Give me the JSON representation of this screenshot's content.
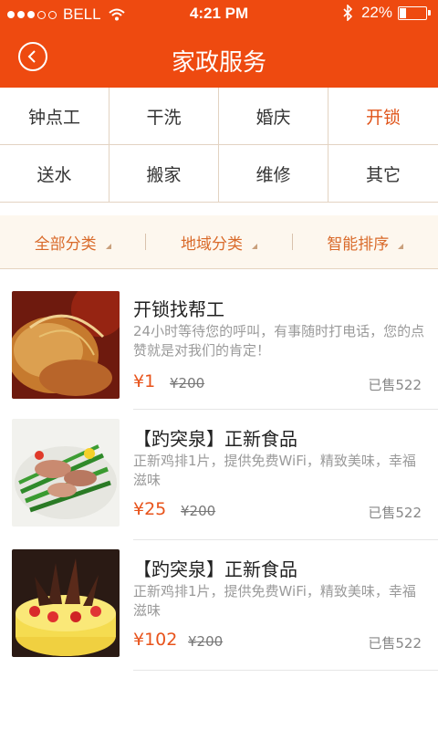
{
  "status_bar": {
    "carrier": "BELL",
    "time": "4:21 PM",
    "battery": "22%"
  },
  "header": {
    "title": "家政服务"
  },
  "categories": [
    "钟点工",
    "干洗",
    "婚庆",
    "开锁",
    "送水",
    "搬家",
    "维修",
    "其它"
  ],
  "active_category": "开锁",
  "filters": [
    "全部分类",
    "地域分类",
    "智能排序"
  ],
  "items": [
    {
      "name": "开锁找帮工",
      "desc": "24小时等待您的呼叫，有事随时打电话，您的点赞就是对我们的肯定！",
      "price": "¥1",
      "old_price": "¥200",
      "sold": "已售522",
      "image": "fried-food-image"
    },
    {
      "name": "【趵突泉】正新食品",
      "desc": "正新鸡排1片，提供免费WiFi，精致美味，幸福滋味",
      "price": "¥25",
      "old_price": "¥200",
      "sold": "已售522",
      "image": "stir-fry-dish-image"
    },
    {
      "name": "【趵突泉】正新食品",
      "desc": "正新鸡排1片，提供免费WiFi，精致美味，幸福滋味",
      "price": "¥102",
      "old_price": "¥200",
      "sold": "已售522",
      "image": "fruit-cake-image"
    }
  ],
  "colors": {
    "header_bg": "#ee4a10",
    "accent": "#e8531b",
    "filter_bg": "#fdf7ee"
  }
}
